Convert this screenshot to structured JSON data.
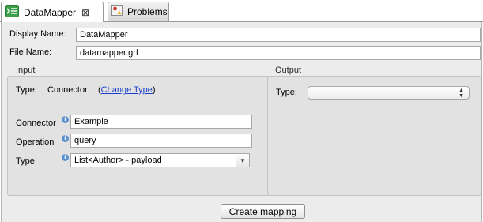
{
  "tabs": [
    {
      "label": "DataMapper",
      "active": true,
      "close_glyph": "⊠"
    },
    {
      "label": "Problems",
      "active": false
    }
  ],
  "form": {
    "display_name_label": "Display Name:",
    "display_name_value": "DataMapper",
    "file_name_label": "File Name:",
    "file_name_value": "datamapper.grf"
  },
  "input": {
    "group_label": "Input",
    "type_label": "Type:",
    "type_value": "Connector",
    "change_type_open": "(",
    "change_type_link": "Change Type",
    "change_type_close": ")",
    "connector_label": "Connector",
    "connector_value": "Example",
    "operation_label": "Operation",
    "operation_value": "query",
    "type_field_label": "Type",
    "type_select_value": "List<Author> - payload"
  },
  "output": {
    "group_label": "Output",
    "type_label": "Type:",
    "type_select_value": ""
  },
  "actions": {
    "create_mapping_label": "Create mapping"
  },
  "icons": {
    "datamapper": "datamapper-icon",
    "problems": "problems-icon",
    "info": "info-icon",
    "close": "close-icon",
    "dropdown": "chevron-down-icon"
  },
  "colors": {
    "panel_bg": "#ececec",
    "group_bg": "#e2e2e2",
    "link": "#1a3ec9",
    "datamapper_icon": "#3aa14a",
    "info_icon": "#5a8fd0"
  }
}
